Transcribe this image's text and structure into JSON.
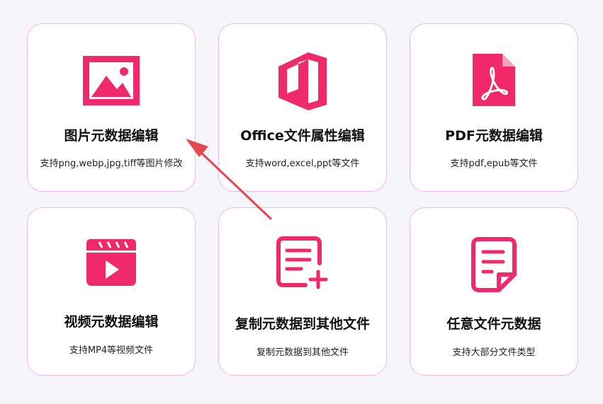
{
  "accent_color": "#f0296a",
  "cards": [
    {
      "title": "图片元数据编辑",
      "desc": "支持png,webp,jpg,tiff等图片修改",
      "icon": "image-icon"
    },
    {
      "title": "Office文件属性编辑",
      "desc": "支持word,excel,ppt等文件",
      "icon": "office-icon"
    },
    {
      "title": "PDF元数据编辑",
      "desc": "支持pdf,epub等文件",
      "icon": "pdf-icon"
    },
    {
      "title": "视频元数据编辑",
      "desc": "支持MP4等视频文件",
      "icon": "video-icon"
    },
    {
      "title": "复制元数据到其他文件",
      "desc": "复制元数据到其他文件",
      "icon": "copy-document-icon"
    },
    {
      "title": "任意文件元数据",
      "desc": "支持大部分文件类型",
      "icon": "file-icon"
    }
  ]
}
